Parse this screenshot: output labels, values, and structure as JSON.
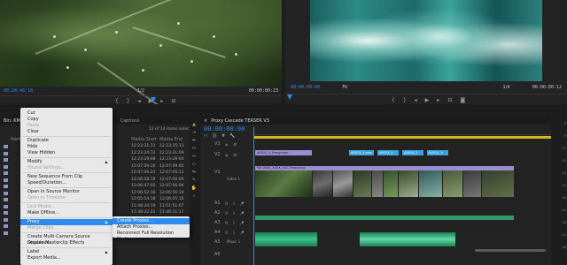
{
  "source": {
    "timecode": "00:24:46:18",
    "fit": "1/2",
    "duration": "00:00:00:23"
  },
  "program": {
    "timecode": "00:00:00:00",
    "fit": "Fit",
    "scale": "1/4",
    "duration": "00:00:00:12"
  },
  "project": {
    "tabs": [
      "Bin: KMc",
      "Captions"
    ],
    "items_selected": "12 of 14 items selected",
    "columns": [
      "Name",
      "Media Start",
      "Media End"
    ],
    "rows": [
      {
        "start": "12:23:31:11",
        "end": "12:23:35:13"
      },
      {
        "start": "12:23:24:12",
        "end": "12:23:31:09"
      },
      {
        "start": "12:23:29:08",
        "end": "12:23:29:04"
      },
      {
        "start": "12:07:09:16",
        "end": "12:07:09:05"
      },
      {
        "start": "12:07:06:23",
        "end": "12:07:06:12"
      },
      {
        "start": "12:06:58:19",
        "end": "12:07:06:09"
      },
      {
        "start": "12:06:47:05",
        "end": "12:07:06:06"
      },
      {
        "start": "12:06:52:18",
        "end": "12:06:56:16"
      },
      {
        "start": "12:05:54:18",
        "end": "12:06:05:16"
      },
      {
        "start": "11:48:24:19",
        "end": "11:51:51:07"
      },
      {
        "start": "11:48:22:22",
        "end": "11:48:31:17"
      },
      {
        "start": "11:46:46:21",
        "end": "11:46:27:21"
      },
      {
        "start": "11:46:19:11",
        "end": "11:46:23:16"
      },
      {
        "start": "11:46:19:11",
        "end": "11:46:23:16"
      }
    ]
  },
  "context_menu": {
    "items": [
      {
        "label": "Cut",
        "enabled": true
      },
      {
        "label": "Copy",
        "enabled": true
      },
      {
        "label": "Paste",
        "enabled": false
      },
      {
        "label": "Clear",
        "enabled": true
      },
      {
        "label": "Duplicate",
        "enabled": true
      },
      {
        "label": "Hide",
        "enabled": true
      },
      {
        "label": "View Hidden",
        "enabled": true
      },
      {
        "label": "Modify",
        "enabled": true,
        "submenu": true
      },
      {
        "label": "Sound Settings...",
        "enabled": false
      },
      {
        "label": "New Sequence From Clip",
        "enabled": true
      },
      {
        "label": "Speed/Duration...",
        "enabled": true
      },
      {
        "label": "Open In Source Monitor",
        "enabled": true
      },
      {
        "label": "Open In Timeline",
        "enabled": false
      },
      {
        "label": "Link Media...",
        "enabled": false
      },
      {
        "label": "Make Offline...",
        "enabled": true
      },
      {
        "label": "Proxy",
        "enabled": true,
        "submenu": true,
        "highlighted": true
      },
      {
        "label": "Merge Clips...",
        "enabled": false
      },
      {
        "label": "Create Multi-Camera Source Sequence...",
        "enabled": true
      },
      {
        "label": "Disable Masterclip Effects",
        "enabled": true
      },
      {
        "label": "Label",
        "enabled": true,
        "submenu": true
      },
      {
        "label": "Export Media...",
        "enabled": true
      }
    ],
    "submenu": [
      {
        "label": "Create Proxies...",
        "highlighted": true
      },
      {
        "label": "Attach Proxies..."
      },
      {
        "label": "Reconnect Full Resolution Media..."
      }
    ]
  },
  "timeline": {
    "tab": "Proxy Cascade TEASER V3",
    "timecode": "00:00:00:00",
    "video_tracks": [
      "V3",
      "V2",
      "V1"
    ],
    "audio_tracks": [
      "A1",
      "A2",
      "A3",
      "A4",
      "A5",
      "A6"
    ],
    "v1_label": "Video 1",
    "a5_label": "Music 1",
    "clips_v3": [
      "A001C_0_Proxy.mov"
    ],
    "clips_v2": [
      "A001X_1.mov",
      "A001X_2",
      "A001X_2",
      "A001X_3"
    ],
    "clips_v1_label": "HD 0006_3AUX_002_Proxy.mov"
  },
  "meter": {
    "labels": [
      "0",
      "-6",
      "-12",
      "-18",
      "-24",
      "-30",
      "-36",
      "-42",
      "-48",
      "-54",
      "dB"
    ]
  }
}
